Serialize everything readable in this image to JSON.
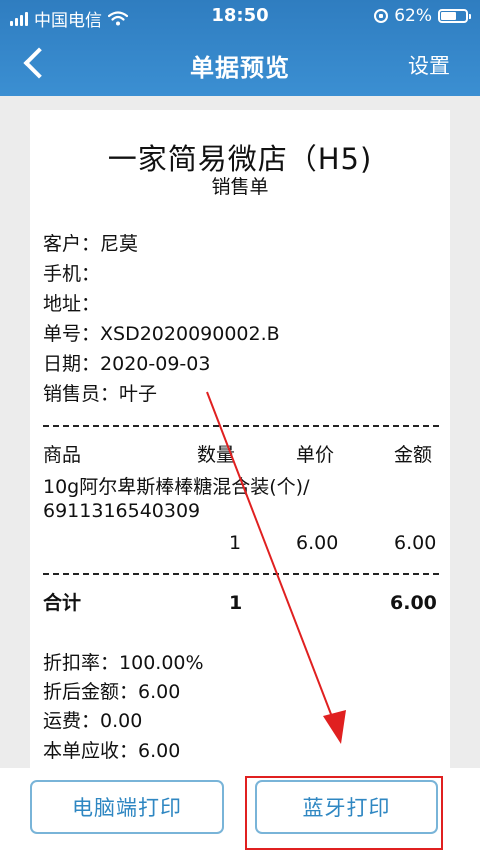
{
  "status_bar": {
    "carrier": "中国电信",
    "time": "18:50",
    "battery": "62%",
    "battery_level": 0.62
  },
  "nav": {
    "title": "单据预览",
    "settings_label": "设置"
  },
  "receipt": {
    "shop_name": "一家简易微店（H5)",
    "doc_type": "销售单",
    "info": [
      {
        "label": "客户：",
        "value": "尼莫"
      },
      {
        "label": "手机：",
        "value": ""
      },
      {
        "label": "地址：",
        "value": ""
      },
      {
        "label": "单号：",
        "value": "XSD2020090002.B"
      },
      {
        "label": "日期：",
        "value": "2020-09-03"
      },
      {
        "label": "销售员：",
        "value": "叶子"
      }
    ],
    "table_headers": {
      "product": "商品",
      "qty": "数量",
      "price": "单价",
      "amount": "金额"
    },
    "item": {
      "name": "10g阿尔卑斯棒棒糖混合装(个)/",
      "barcode": "6911316540309",
      "qty": "1",
      "price": "6.00",
      "amount": "6.00"
    },
    "total": {
      "label": "合计",
      "qty": "1",
      "amount": "6.00"
    },
    "summary": [
      {
        "label": "折扣率：",
        "value": "100.00%"
      },
      {
        "label": "折后金额：",
        "value": "6.00"
      },
      {
        "label": "运费：",
        "value": "0.00"
      },
      {
        "label": "本单应收：",
        "value": "6.00"
      }
    ]
  },
  "buttons": {
    "pc_print": "电脑端打印",
    "bluetooth_print": "蓝牙打印"
  },
  "colors": {
    "accent": "#3b8fd2",
    "button_text": "#2f87c2",
    "annotation": "#e02020"
  }
}
